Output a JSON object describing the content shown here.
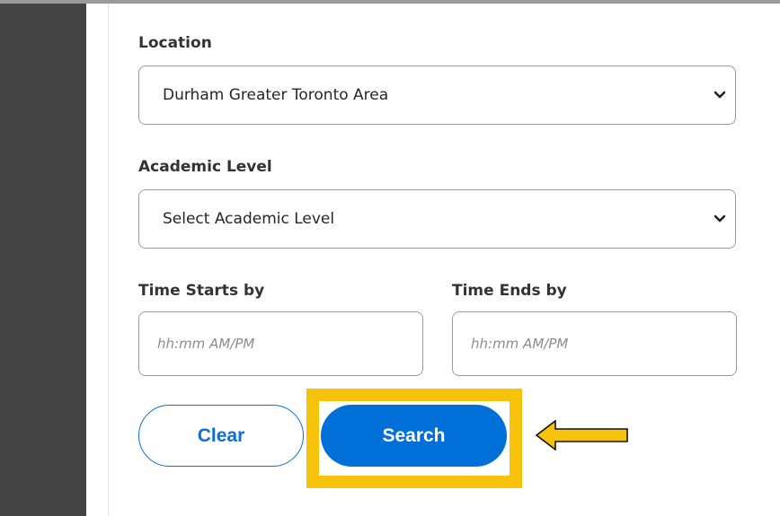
{
  "form": {
    "location": {
      "label": "Location",
      "selected": "Durham Greater Toronto Area"
    },
    "academic_level": {
      "label": "Academic Level",
      "selected": "Select Academic Level"
    },
    "time_starts": {
      "label": "Time Starts by",
      "placeholder": "hh:mm AM/PM"
    },
    "time_ends": {
      "label": "Time Ends by",
      "placeholder": "hh:mm AM/PM"
    }
  },
  "buttons": {
    "clear_label": "Clear",
    "search_label": "Search"
  },
  "colors": {
    "sidebar": "#444444",
    "primary": "#0070d8",
    "highlight": "#f7c20a",
    "arrow": "#f7c20a"
  },
  "icons": {
    "select_chevron": "chevron-down-icon",
    "pointer_arrow": "arrow-left-icon"
  }
}
